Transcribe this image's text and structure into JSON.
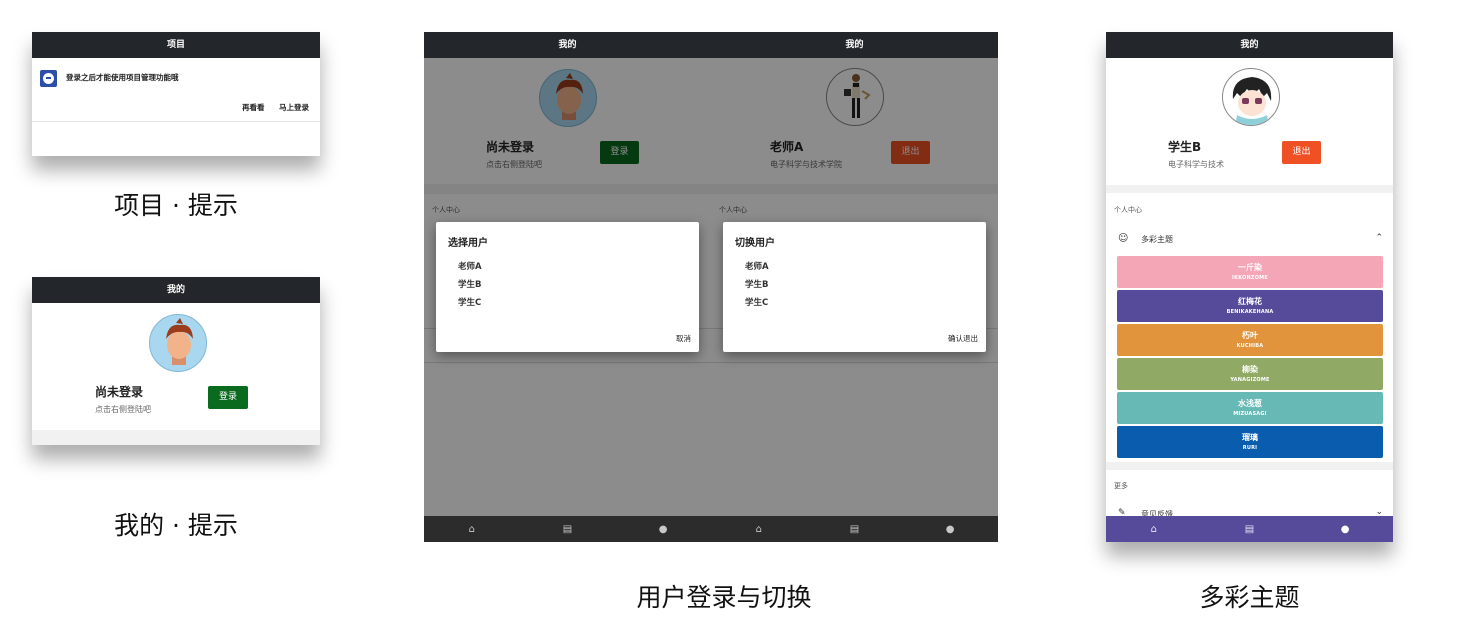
{
  "panel1": {
    "title": "项目",
    "app_icon": "app-logo-icon",
    "message": "登录之后才能使用项目管理功能哦",
    "later": "再看看",
    "login_now": "马上登录",
    "caption": "项目 · 提示"
  },
  "panel2": {
    "title": "我的",
    "name": "尚未登录",
    "sub": "点击右侧登陆吧",
    "login": "登录",
    "caption": "我的 · 提示"
  },
  "panel3": {
    "left": {
      "title": "我的",
      "name": "尚未登录",
      "sub": "点击右侧登陆吧",
      "login": "登录",
      "section": "个人中心",
      "dialog_title": "选择用户",
      "users": [
        "老师A",
        "学生B",
        "学生C"
      ],
      "cancel": "取消"
    },
    "right": {
      "title": "我的",
      "name": "老师A",
      "sub": "电子科学与技术学院",
      "logout": "退出",
      "section": "个人中心",
      "dialog_title": "切换用户",
      "users": [
        "老师A",
        "学生B",
        "学生C"
      ],
      "confirm_logout": "确认退出"
    },
    "caption": "用户登录与切换"
  },
  "panel4": {
    "title": "我的",
    "name": "学生B",
    "sub": "电子科学与技术",
    "logout": "退出",
    "section": "个人中心",
    "theme_label": "多彩主题",
    "themes": [
      {
        "name": "一斤染",
        "roman": "IKKONZOME",
        "color": "#f4a6b7"
      },
      {
        "name": "红梅花",
        "roman": "BENIKAKEHANA",
        "color": "#554b9a"
      },
      {
        "name": "朽叶",
        "roman": "KUCHIBA",
        "color": "#e1943c"
      },
      {
        "name": "柳染",
        "roman": "YANAGIZOME",
        "color": "#90aa65"
      },
      {
        "name": "水浅葱",
        "roman": "MIZUASAGI",
        "color": "#66b9b5"
      },
      {
        "name": "瑠璃",
        "roman": "RURI",
        "color": "#0a5cae"
      }
    ],
    "more": "更多",
    "feedback": "意见反馈",
    "tabbar_color": "#554b9a",
    "caption": "多彩主题"
  },
  "colors": {
    "topbar": "#23272b",
    "login_button": "#0a6a1e",
    "logout_button": "#ef5125"
  }
}
